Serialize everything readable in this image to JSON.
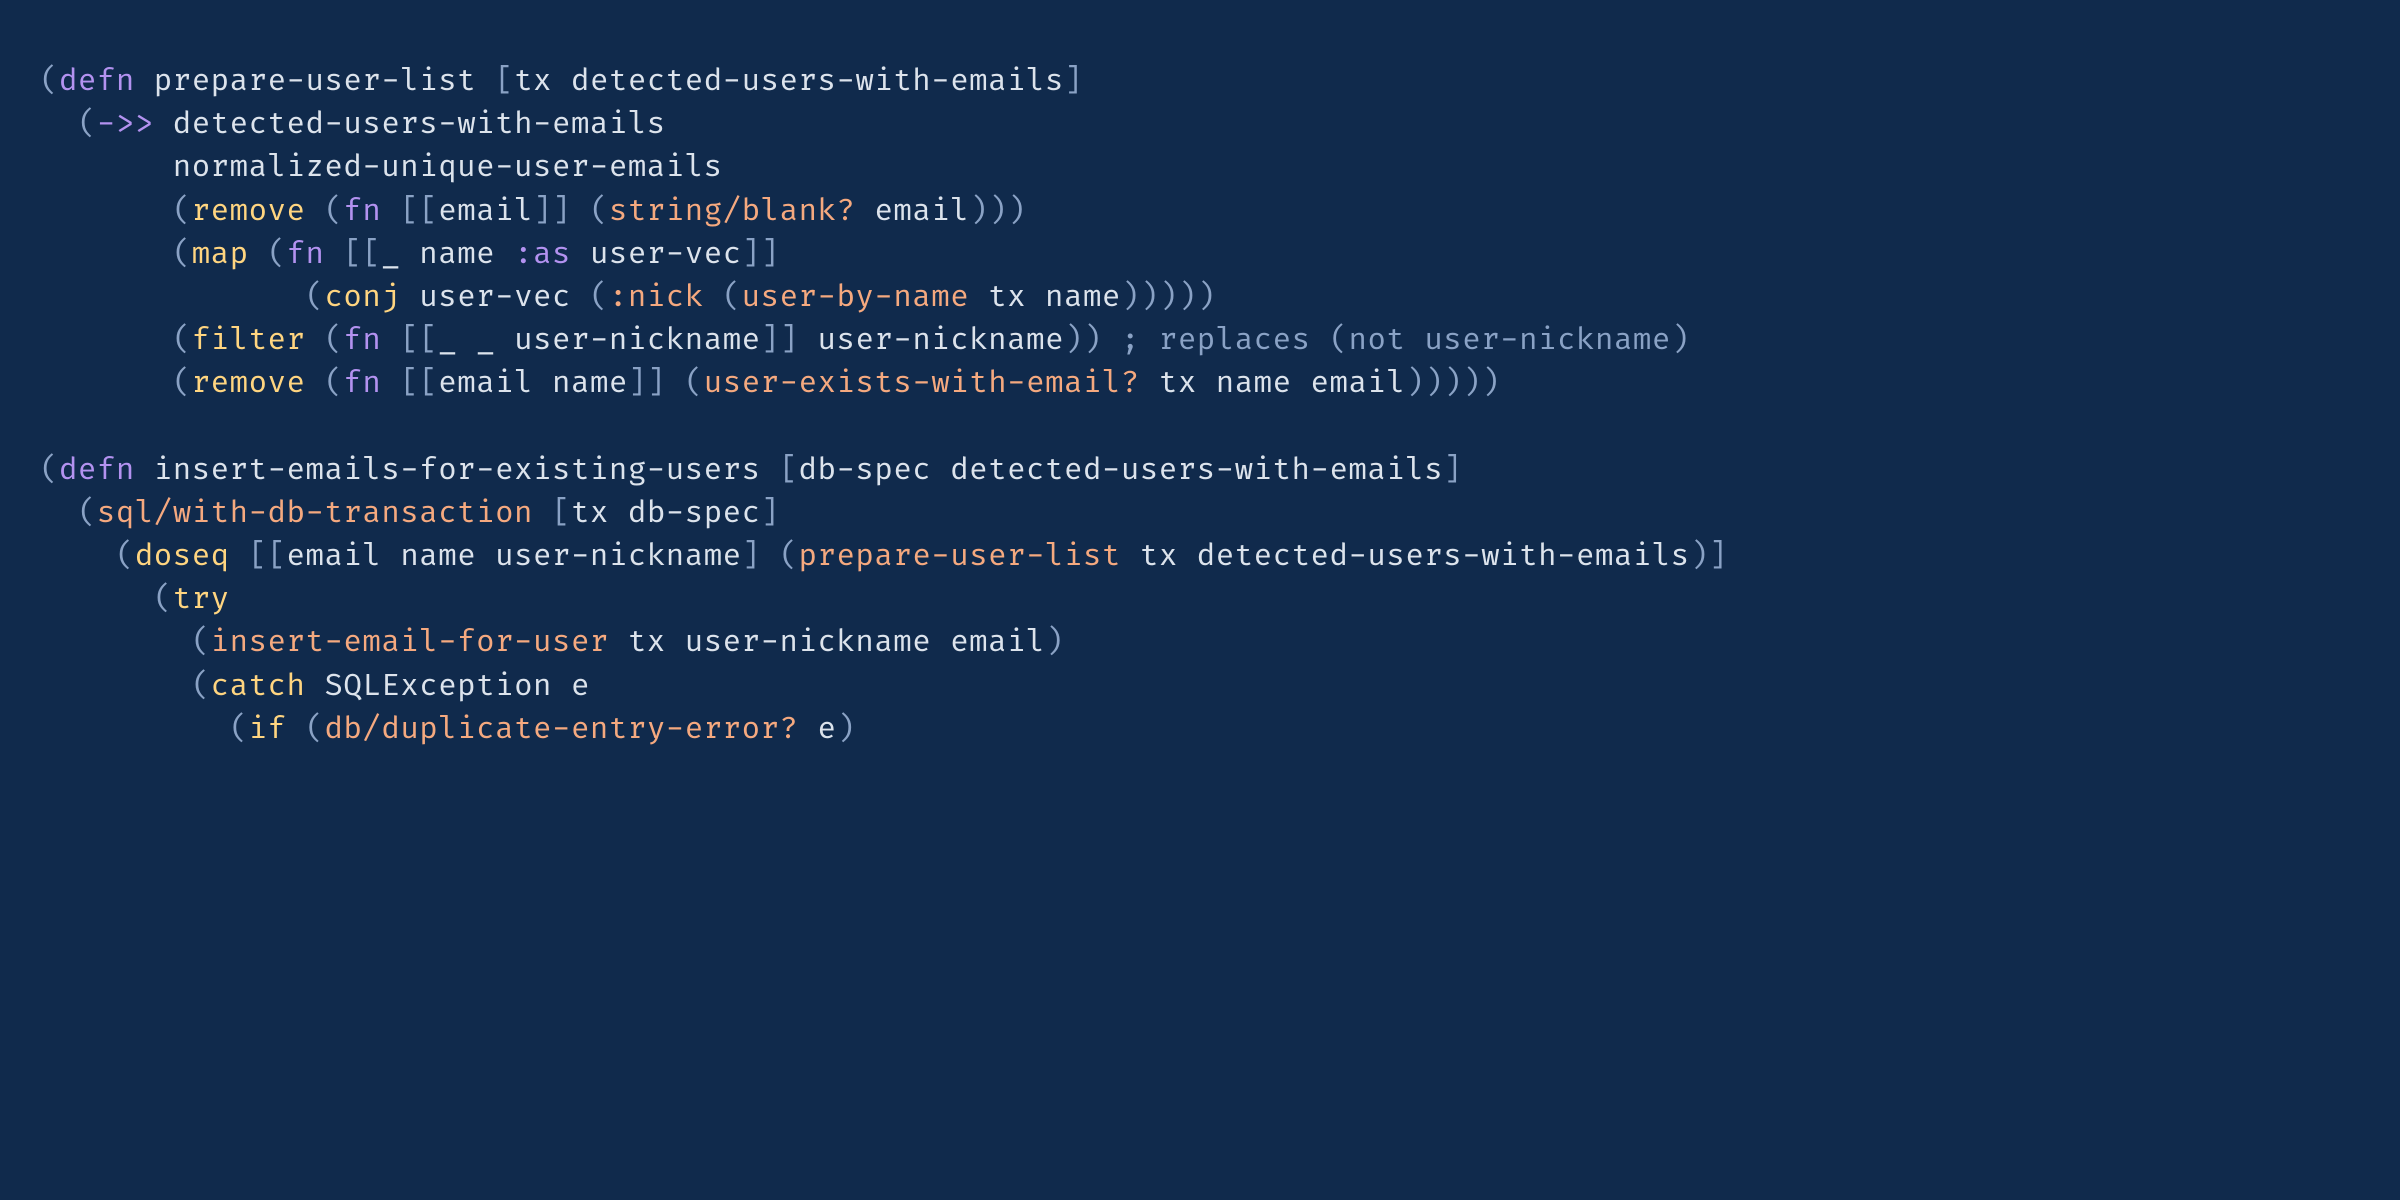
{
  "code": {
    "lines": [
      [
        {
          "cls": "tok-punct",
          "t": "("
        },
        {
          "cls": "tok-keyword",
          "t": "defn"
        },
        {
          "cls": "tok-default",
          "t": " "
        },
        {
          "cls": "tok-name",
          "t": "prepare-user-list"
        },
        {
          "cls": "tok-default",
          "t": " "
        },
        {
          "cls": "tok-punct",
          "t": "["
        },
        {
          "cls": "tok-name",
          "t": "tx detected-users-with-emails"
        },
        {
          "cls": "tok-punct",
          "t": "]"
        }
      ],
      [
        {
          "cls": "tok-default",
          "t": "  "
        },
        {
          "cls": "tok-punct",
          "t": "("
        },
        {
          "cls": "tok-keyword",
          "t": "->>"
        },
        {
          "cls": "tok-default",
          "t": " "
        },
        {
          "cls": "tok-name",
          "t": "detected-users-with-emails"
        }
      ],
      [
        {
          "cls": "tok-default",
          "t": "       "
        },
        {
          "cls": "tok-name",
          "t": "normalized-unique-user-emails"
        }
      ],
      [
        {
          "cls": "tok-default",
          "t": "       "
        },
        {
          "cls": "tok-punct",
          "t": "("
        },
        {
          "cls": "tok-builtin",
          "t": "remove"
        },
        {
          "cls": "tok-default",
          "t": " "
        },
        {
          "cls": "tok-punct",
          "t": "("
        },
        {
          "cls": "tok-keyword",
          "t": "fn"
        },
        {
          "cls": "tok-default",
          "t": " "
        },
        {
          "cls": "tok-punct",
          "t": "[["
        },
        {
          "cls": "tok-name",
          "t": "email"
        },
        {
          "cls": "tok-punct",
          "t": "]]"
        },
        {
          "cls": "tok-default",
          "t": " "
        },
        {
          "cls": "tok-punct",
          "t": "("
        },
        {
          "cls": "tok-fncall",
          "t": "string/blank?"
        },
        {
          "cls": "tok-default",
          "t": " "
        },
        {
          "cls": "tok-name",
          "t": "email"
        },
        {
          "cls": "tok-punct",
          "t": ")))"
        }
      ],
      [
        {
          "cls": "tok-default",
          "t": "       "
        },
        {
          "cls": "tok-punct",
          "t": "("
        },
        {
          "cls": "tok-builtin",
          "t": "map"
        },
        {
          "cls": "tok-default",
          "t": " "
        },
        {
          "cls": "tok-punct",
          "t": "("
        },
        {
          "cls": "tok-keyword",
          "t": "fn"
        },
        {
          "cls": "tok-default",
          "t": " "
        },
        {
          "cls": "tok-punct",
          "t": "[["
        },
        {
          "cls": "tok-name",
          "t": "_ name "
        },
        {
          "cls": "tok-keyword",
          "t": ":as"
        },
        {
          "cls": "tok-name",
          "t": " user-vec"
        },
        {
          "cls": "tok-punct",
          "t": "]]"
        }
      ],
      [
        {
          "cls": "tok-default",
          "t": "              "
        },
        {
          "cls": "tok-punct",
          "t": "("
        },
        {
          "cls": "tok-builtin",
          "t": "conj"
        },
        {
          "cls": "tok-default",
          "t": " "
        },
        {
          "cls": "tok-name",
          "t": "user-vec "
        },
        {
          "cls": "tok-punct",
          "t": "("
        },
        {
          "cls": "tok-kw2",
          "t": ":nick"
        },
        {
          "cls": "tok-default",
          "t": " "
        },
        {
          "cls": "tok-punct",
          "t": "("
        },
        {
          "cls": "tok-fncall",
          "t": "user-by-name"
        },
        {
          "cls": "tok-default",
          "t": " "
        },
        {
          "cls": "tok-name",
          "t": "tx name"
        },
        {
          "cls": "tok-punct",
          "t": ")))))"
        }
      ],
      [
        {
          "cls": "tok-default",
          "t": "       "
        },
        {
          "cls": "tok-punct",
          "t": "("
        },
        {
          "cls": "tok-builtin",
          "t": "filter"
        },
        {
          "cls": "tok-default",
          "t": " "
        },
        {
          "cls": "tok-punct",
          "t": "("
        },
        {
          "cls": "tok-keyword",
          "t": "fn"
        },
        {
          "cls": "tok-default",
          "t": " "
        },
        {
          "cls": "tok-punct",
          "t": "[["
        },
        {
          "cls": "tok-name",
          "t": "_ _ user-nickname"
        },
        {
          "cls": "tok-punct",
          "t": "]]"
        },
        {
          "cls": "tok-default",
          "t": " "
        },
        {
          "cls": "tok-name",
          "t": "user-nickname"
        },
        {
          "cls": "tok-punct",
          "t": "))"
        },
        {
          "cls": "tok-default",
          "t": " "
        },
        {
          "cls": "tok-comment",
          "t": "; replaces (not user-nickname)"
        }
      ],
      [
        {
          "cls": "tok-default",
          "t": "       "
        },
        {
          "cls": "tok-punct",
          "t": "("
        },
        {
          "cls": "tok-builtin",
          "t": "remove"
        },
        {
          "cls": "tok-default",
          "t": " "
        },
        {
          "cls": "tok-punct",
          "t": "("
        },
        {
          "cls": "tok-keyword",
          "t": "fn"
        },
        {
          "cls": "tok-default",
          "t": " "
        },
        {
          "cls": "tok-punct",
          "t": "[["
        },
        {
          "cls": "tok-name",
          "t": "email name"
        },
        {
          "cls": "tok-punct",
          "t": "]]"
        },
        {
          "cls": "tok-default",
          "t": " "
        },
        {
          "cls": "tok-punct",
          "t": "("
        },
        {
          "cls": "tok-fncall",
          "t": "user-exists-with-email?"
        },
        {
          "cls": "tok-default",
          "t": " "
        },
        {
          "cls": "tok-name",
          "t": "tx name email"
        },
        {
          "cls": "tok-punct",
          "t": ")))))"
        }
      ],
      [
        {
          "cls": "tok-default",
          "t": ""
        }
      ],
      [
        {
          "cls": "tok-punct",
          "t": "("
        },
        {
          "cls": "tok-keyword",
          "t": "defn"
        },
        {
          "cls": "tok-default",
          "t": " "
        },
        {
          "cls": "tok-name",
          "t": "insert-emails-for-existing-users"
        },
        {
          "cls": "tok-default",
          "t": " "
        },
        {
          "cls": "tok-punct",
          "t": "["
        },
        {
          "cls": "tok-name",
          "t": "db-spec detected-users-with-emails"
        },
        {
          "cls": "tok-punct",
          "t": "]"
        }
      ],
      [
        {
          "cls": "tok-default",
          "t": "  "
        },
        {
          "cls": "tok-punct",
          "t": "("
        },
        {
          "cls": "tok-fncall",
          "t": "sql/with-db-transaction"
        },
        {
          "cls": "tok-default",
          "t": " "
        },
        {
          "cls": "tok-punct",
          "t": "["
        },
        {
          "cls": "tok-name",
          "t": "tx db-spec"
        },
        {
          "cls": "tok-punct",
          "t": "]"
        }
      ],
      [
        {
          "cls": "tok-default",
          "t": "    "
        },
        {
          "cls": "tok-punct",
          "t": "("
        },
        {
          "cls": "tok-builtin",
          "t": "doseq"
        },
        {
          "cls": "tok-default",
          "t": " "
        },
        {
          "cls": "tok-punct",
          "t": "[["
        },
        {
          "cls": "tok-name",
          "t": "email name user-nickname"
        },
        {
          "cls": "tok-punct",
          "t": "]"
        },
        {
          "cls": "tok-default",
          "t": " "
        },
        {
          "cls": "tok-punct",
          "t": "("
        },
        {
          "cls": "tok-fncall",
          "t": "prepare-user-list"
        },
        {
          "cls": "tok-default",
          "t": " "
        },
        {
          "cls": "tok-name",
          "t": "tx detected-users-with-emails"
        },
        {
          "cls": "tok-punct",
          "t": ")]"
        }
      ],
      [
        {
          "cls": "tok-default",
          "t": "      "
        },
        {
          "cls": "tok-punct",
          "t": "("
        },
        {
          "cls": "tok-builtin",
          "t": "try"
        }
      ],
      [
        {
          "cls": "tok-default",
          "t": "        "
        },
        {
          "cls": "tok-punct",
          "t": "("
        },
        {
          "cls": "tok-fncall",
          "t": "insert-email-for-user"
        },
        {
          "cls": "tok-default",
          "t": " "
        },
        {
          "cls": "tok-name",
          "t": "tx user-nickname email"
        },
        {
          "cls": "tok-punct",
          "t": ")"
        }
      ],
      [
        {
          "cls": "tok-default",
          "t": "        "
        },
        {
          "cls": "tok-punct",
          "t": "("
        },
        {
          "cls": "tok-builtin",
          "t": "catch"
        },
        {
          "cls": "tok-default",
          "t": " "
        },
        {
          "cls": "tok-name",
          "t": "SQLException e"
        }
      ],
      [
        {
          "cls": "tok-default",
          "t": "          "
        },
        {
          "cls": "tok-punct",
          "t": "("
        },
        {
          "cls": "tok-builtin",
          "t": "if"
        },
        {
          "cls": "tok-default",
          "t": " "
        },
        {
          "cls": "tok-punct",
          "t": "("
        },
        {
          "cls": "tok-fncall",
          "t": "db/duplicate-entry-error?"
        },
        {
          "cls": "tok-default",
          "t": " "
        },
        {
          "cls": "tok-name",
          "t": "e"
        },
        {
          "cls": "tok-punct",
          "t": ")"
        }
      ]
    ]
  }
}
